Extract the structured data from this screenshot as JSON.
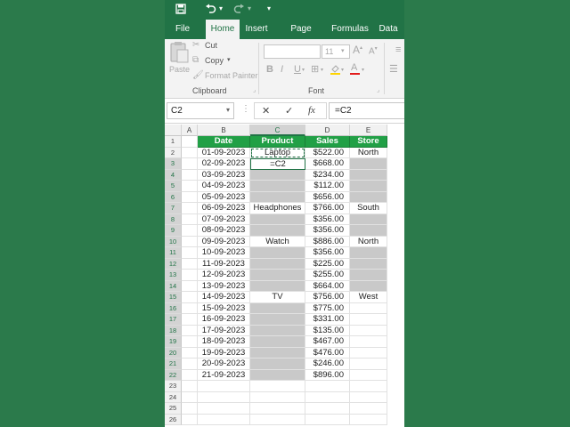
{
  "colors": {
    "brand": "#217346",
    "header_fill": "#21a046",
    "selection_fill": "#c9c9c9",
    "background": "#2b7a4b"
  },
  "qat": {
    "dropdown": "▾",
    "customize": "▾"
  },
  "tabs": [
    {
      "label": "File"
    },
    {
      "label": "Home"
    },
    {
      "label": "Insert"
    },
    {
      "label": "Page Layout"
    },
    {
      "label": "Formulas"
    },
    {
      "label": "Data"
    }
  ],
  "ribbon": {
    "paste_label": "Paste",
    "cut_label": "Cut",
    "copy_label": "Copy",
    "format_painter_label": "Format Painter",
    "clipboard_group": "Clipboard",
    "font_group": "Font",
    "font_size": "11",
    "bold": "B",
    "italic": "I",
    "underline": "U"
  },
  "formula_bar": {
    "name_box": "C2",
    "cancel": "✕",
    "enter": "✓",
    "fx": "fx",
    "formula": "=C2"
  },
  "columns": [
    "A",
    "B",
    "C",
    "D",
    "E"
  ],
  "rows": [
    "1",
    "2",
    "3",
    "4",
    "5",
    "6",
    "7",
    "8",
    "9",
    "10",
    "11",
    "12",
    "13",
    "14",
    "15",
    "16",
    "17",
    "18",
    "19",
    "20",
    "21",
    "22",
    "23",
    "24",
    "25",
    "26"
  ],
  "table": {
    "headers": [
      "Date",
      "Product",
      "Sales",
      "Store"
    ],
    "rows": [
      {
        "date": "01-09-2023",
        "product": "Laptop",
        "sales": "$522.00",
        "store": "North"
      },
      {
        "date": "02-09-2023",
        "product": "=C2",
        "sales": "$668.00",
        "store": ""
      },
      {
        "date": "03-09-2023",
        "product": "",
        "sales": "$234.00",
        "store": ""
      },
      {
        "date": "04-09-2023",
        "product": "",
        "sales": "$112.00",
        "store": ""
      },
      {
        "date": "05-09-2023",
        "product": "",
        "sales": "$656.00",
        "store": ""
      },
      {
        "date": "06-09-2023",
        "product": "Headphones",
        "sales": "$766.00",
        "store": "South"
      },
      {
        "date": "07-09-2023",
        "product": "",
        "sales": "$356.00",
        "store": ""
      },
      {
        "date": "08-09-2023",
        "product": "",
        "sales": "$356.00",
        "store": ""
      },
      {
        "date": "09-09-2023",
        "product": "Watch",
        "sales": "$886.00",
        "store": "North"
      },
      {
        "date": "10-09-2023",
        "product": "",
        "sales": "$356.00",
        "store": ""
      },
      {
        "date": "11-09-2023",
        "product": "",
        "sales": "$225.00",
        "store": ""
      },
      {
        "date": "12-09-2023",
        "product": "",
        "sales": "$255.00",
        "store": ""
      },
      {
        "date": "13-09-2023",
        "product": "",
        "sales": "$664.00",
        "store": ""
      },
      {
        "date": "14-09-2023",
        "product": "TV",
        "sales": "$756.00",
        "store": "West"
      },
      {
        "date": "15-09-2023",
        "product": "",
        "sales": "$775.00",
        "store": ""
      },
      {
        "date": "16-09-2023",
        "product": "",
        "sales": "$331.00",
        "store": ""
      },
      {
        "date": "17-09-2023",
        "product": "",
        "sales": "$135.00",
        "store": ""
      },
      {
        "date": "18-09-2023",
        "product": "",
        "sales": "$467.00",
        "store": ""
      },
      {
        "date": "19-09-2023",
        "product": "",
        "sales": "$476.00",
        "store": ""
      },
      {
        "date": "20-09-2023",
        "product": "",
        "sales": "$246.00",
        "store": ""
      },
      {
        "date": "21-09-2023",
        "product": "",
        "sales": "$896.00",
        "store": ""
      }
    ]
  }
}
